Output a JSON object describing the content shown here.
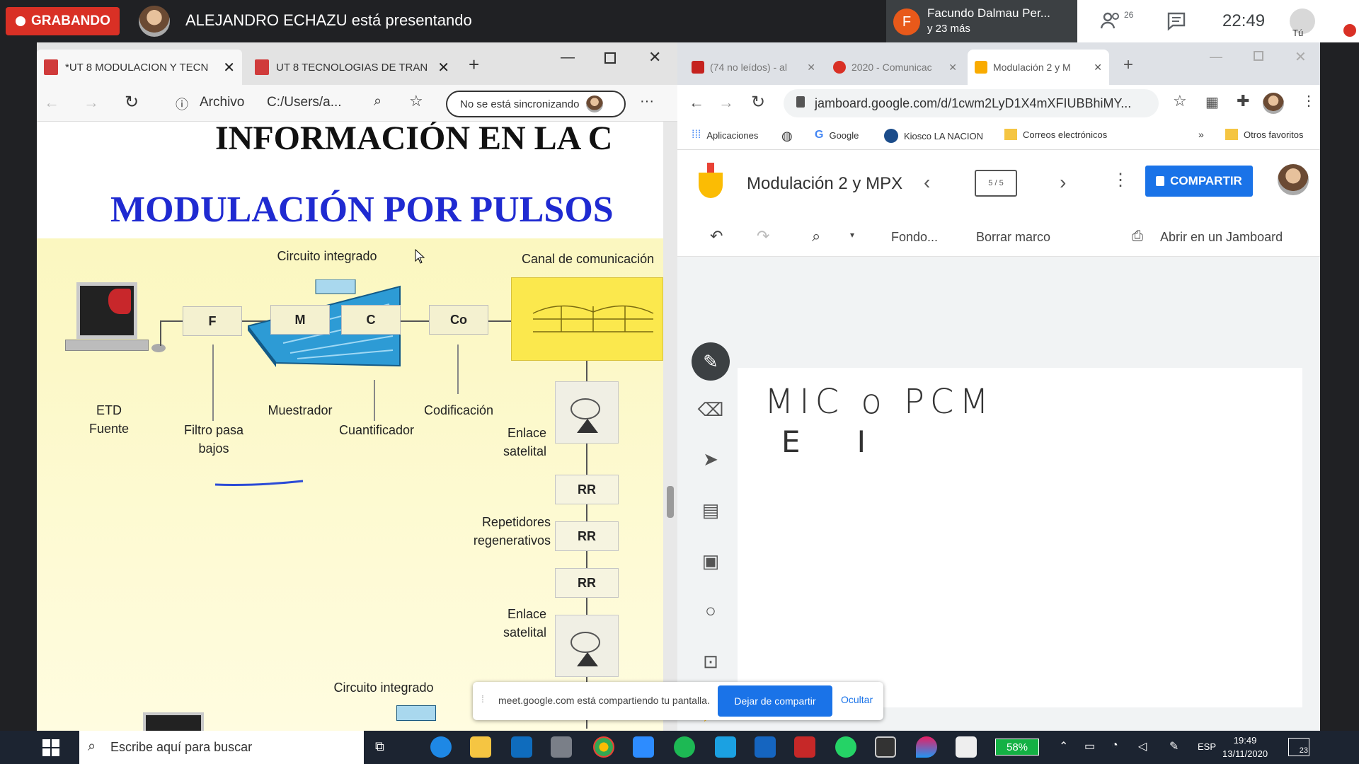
{
  "meet": {
    "recording_label": "GRABANDO",
    "presenter_text": "ALEJANDRO ECHAZU está presentando",
    "participant_initial": "F",
    "participant_name": "Facundo Dalmau Per...",
    "participant_more": "y 23 más",
    "people_count": "26",
    "time": "22:49",
    "self_label": "Tú"
  },
  "pdf_browser": {
    "tabs": [
      {
        "title": "*UT 8 MODULACION Y TECN"
      },
      {
        "title": "UT 8 TECNOLOGIAS DE TRAN"
      }
    ],
    "new_tab": "+",
    "address_prefix": "Archivo",
    "address": "C:/Users/a...",
    "sync_label": "No se está sincronizando",
    "more": "···"
  },
  "pdf_content": {
    "heading1": "INFORMACIÓN EN LA C",
    "heading2": "MODULACIÓN POR PULSOS",
    "figure": {
      "label_ci_top": "Circuito integrado",
      "label_canal": "Canal de comunicación",
      "box_f": "F",
      "box_m": "M",
      "box_c": "C",
      "box_co": "Co",
      "label_etd": "ETD",
      "label_fuente": "Fuente",
      "label_filtro1": "Filtro pasa",
      "label_filtro2": "bajos",
      "label_muestreador": "Muestrador",
      "label_cuantificador": "Cuantificador",
      "label_codificacion": "Codificación",
      "label_enlace1a": "Enlace",
      "label_enlace1b": "satelital",
      "rr": [
        "RR",
        "RR",
        "RR"
      ],
      "label_rep1": "Repetidores",
      "label_rep2": "regenerativos",
      "label_enlace2a": "Enlace",
      "label_enlace2b": "satelital",
      "label_ci_bottom": "Circuito integrado"
    }
  },
  "chrome": {
    "tabs": [
      {
        "title": "(74 no leídos) - al"
      },
      {
        "title": "2020 - Comunicac"
      },
      {
        "title": "Modulación 2 y M"
      }
    ],
    "new_tab": "+",
    "url": "jamboard.google.com/d/1cwm2LyD1X4mXFIUBBhiMY...",
    "bookmarks": [
      {
        "label": "Aplicaciones"
      },
      {
        "label": "Google"
      },
      {
        "label": "Kiosco LA NACION"
      },
      {
        "label": "Correos electrónicos"
      }
    ],
    "bookmarks_more": "»",
    "other_bookmarks": "Otros favoritos"
  },
  "jamboard": {
    "title": "Modulación 2 y MPX",
    "frame_counter": "5 / 5",
    "share_label": "COMPARTIR",
    "background_label": "Fondo...",
    "clear_label": "Borrar marco",
    "open_label": "Abrir en un Jamboard",
    "ink": {
      "line1": "MIC o PCM",
      "line2": "E      I"
    }
  },
  "screen_share": {
    "message": "meet.google.com está compartiendo tu pantalla.",
    "stop_label": "Dejar de compartir",
    "hide_label": "Ocultar"
  },
  "taskbar": {
    "search_placeholder": "Escribe aquí para buscar",
    "battery": "58%",
    "lang": "ESP",
    "time": "19:49",
    "date": "13/11/2020",
    "notif_count": "23"
  },
  "colors": {
    "recording": "#d93025",
    "meet_bg": "#202124",
    "accent_blue": "#1a73e8",
    "slide_heading_blue": "#1f2ad1",
    "figure_bg": "#fbf7c0",
    "taskbar": "#1c2431"
  }
}
